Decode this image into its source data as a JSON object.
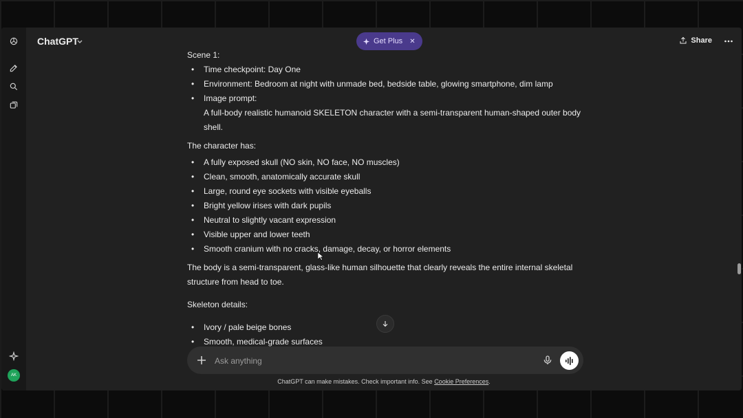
{
  "header": {
    "model_name": "ChatGPT",
    "get_plus_label": "Get Plus",
    "share_label": "Share"
  },
  "sidebar": {
    "icons": [
      "chatgpt-logo-icon",
      "new-chat-icon",
      "search-icon",
      "library-icon",
      "sparkle-icon"
    ],
    "avatar_initials": "AK"
  },
  "message": {
    "scene_heading": "Scene 1:",
    "scene_items": [
      "Time checkpoint: Day One",
      "Environment: Bedroom at night with unmade bed, bedside table, glowing smartphone, dim lamp",
      "Image prompt:"
    ],
    "image_prompt_text": "A full-body realistic humanoid SKELETON character with a semi-transparent human-shaped outer body shell.",
    "character_heading": "The character has:",
    "character_items": [
      "A fully exposed skull (NO skin, NO face, NO muscles)",
      "Clean, smooth, anatomically accurate skull",
      "Large, round eye sockets with visible eyeballs",
      "Bright yellow irises with dark pupils",
      "Neutral to slightly vacant expression",
      "Visible upper and lower teeth",
      "Smooth cranium with no cracks, damage, decay, or horror elements"
    ],
    "body_paragraph": "The body is a semi-transparent, glass-like human silhouette that clearly reveals the entire internal skeletal structure from head to toe.",
    "skeleton_heading": "Skeleton details:",
    "skeleton_items": [
      "Ivory / pale beige bones",
      "Smooth, medical-grade surfaces"
    ]
  },
  "composer": {
    "placeholder": "Ask anything"
  },
  "footer": {
    "disclaimer_text": "ChatGPT can make mistakes. Check important info. See ",
    "cookie_link": "Cookie Preferences",
    "disclaimer_end": "."
  },
  "colors": {
    "background": "#212121",
    "rail": "#181818",
    "composer": "#303030",
    "plus_badge": "#4a3a8c",
    "avatar": "#1fa35a"
  }
}
